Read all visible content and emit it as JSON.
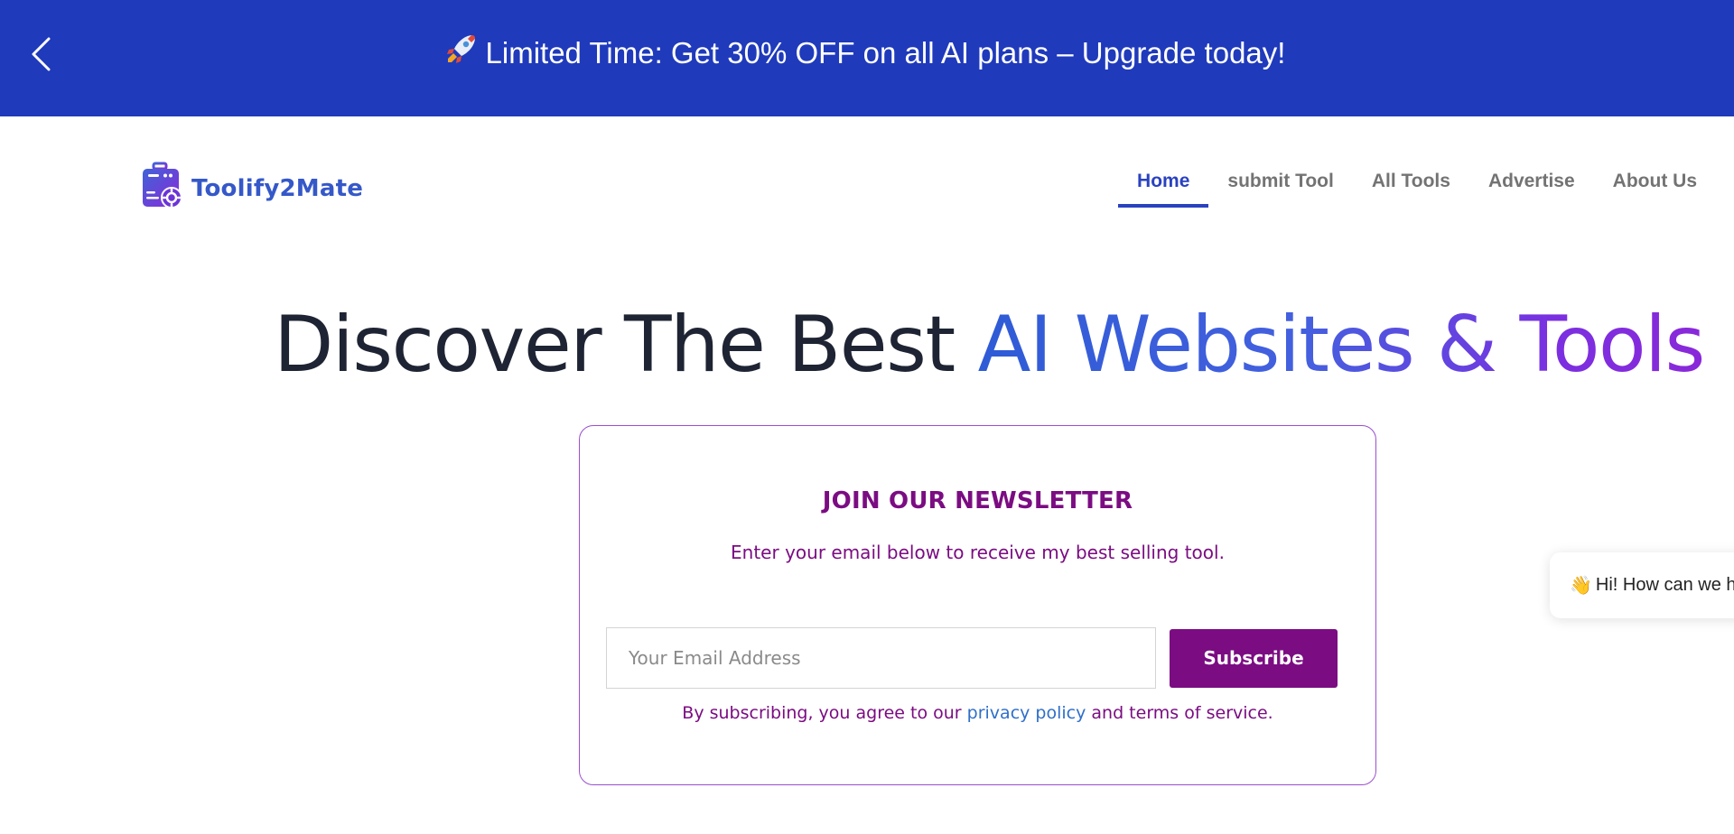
{
  "promo": {
    "text": "Limited Time: Get 30% OFF on all AI plans – Upgrade today!",
    "emoji": "🚀"
  },
  "header": {
    "logo_text": "Toolify2Mate",
    "nav": [
      {
        "label": "Home",
        "active": true
      },
      {
        "label": "submit Tool",
        "active": false
      },
      {
        "label": "All Tools",
        "active": false
      },
      {
        "label": "Advertise",
        "active": false
      },
      {
        "label": "About Us",
        "active": false
      }
    ]
  },
  "hero": {
    "title_plain": "Discover The Best ",
    "title_highlight": "AI Websites & Tools"
  },
  "newsletter": {
    "title": "JOIN OUR NEWSLETTER",
    "subtitle": "Enter your email below to receive my best selling tool.",
    "email_placeholder": "Your Email Address",
    "email_value": "",
    "subscribe_label": "Subscribe",
    "consent_prefix": "By subscribing, you agree to our ",
    "privacy_link": "privacy policy",
    "consent_suffix": " and terms of service."
  },
  "chat": {
    "emoji": "👋",
    "text": "Hi! How can we help?"
  },
  "colors": {
    "promo_bg": "#1f3abb",
    "brand_purple": "#7b0c82",
    "nav_active": "#2a42c0",
    "logo_blue": "#3558c9"
  }
}
